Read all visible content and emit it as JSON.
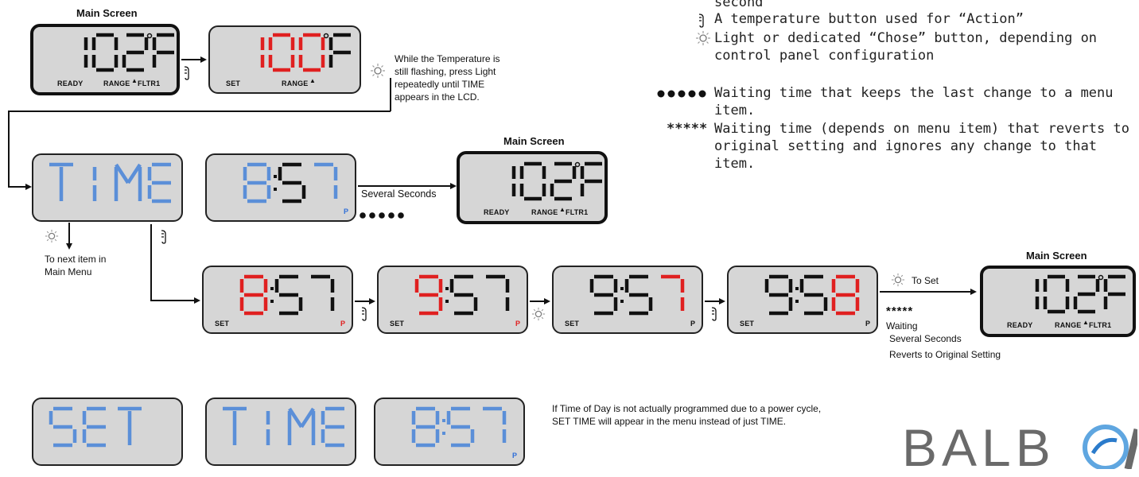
{
  "legend": {
    "line0": "second",
    "temp_button": "A temperature button used for “Action”",
    "light_button_1": "Light or dedicated “Chose” button, depending on",
    "light_button_2": "control panel configuration",
    "wait_dots_1": "Waiting time that keeps the last change to a menu",
    "wait_dots_2": "item.",
    "wait_stars_symbol": "*****",
    "wait_stars_1": "Waiting time (depends on menu item) that reverts to",
    "wait_stars_2": "original setting and ignores any change to that",
    "wait_stars_3": "item."
  },
  "labels": {
    "main_screen": "Main Screen",
    "ready": "READY",
    "range": "RANGE",
    "fltr1": "FLTR1",
    "set": "SET",
    "p": "P"
  },
  "flow": {
    "instruction_1": "While the Temperature is",
    "instruction_2": "still flashing, press Light",
    "instruction_3": "repeatedly until TIME",
    "instruction_4": "appears in the LCD.",
    "several_seconds": "Several Seconds",
    "next_item_1": "To next item in",
    "next_item_2": "Main Menu",
    "to_set": "To Set",
    "stars": "*****",
    "waiting": "Waiting",
    "several_seconds_2": "Several Seconds",
    "reverts": "Reverts to Original Setting",
    "power_cycle_1": "If Time of Day is not actually programmed due to a power cycle,",
    "power_cycle_2": "SET TIME will appear in the menu instead of just TIME."
  },
  "brand": {
    "logo_text": "BALB"
  },
  "colors": {
    "lcd_bg": "#d6d6d6",
    "digit_black": "#111111",
    "digit_red": "#e02020",
    "digit_blue": "#5b8fd8",
    "logo": "#6a6a6a"
  },
  "lcd_text": [
    "102F",
    "100F",
    "TIME",
    "8:57",
    "SET"
  ]
}
